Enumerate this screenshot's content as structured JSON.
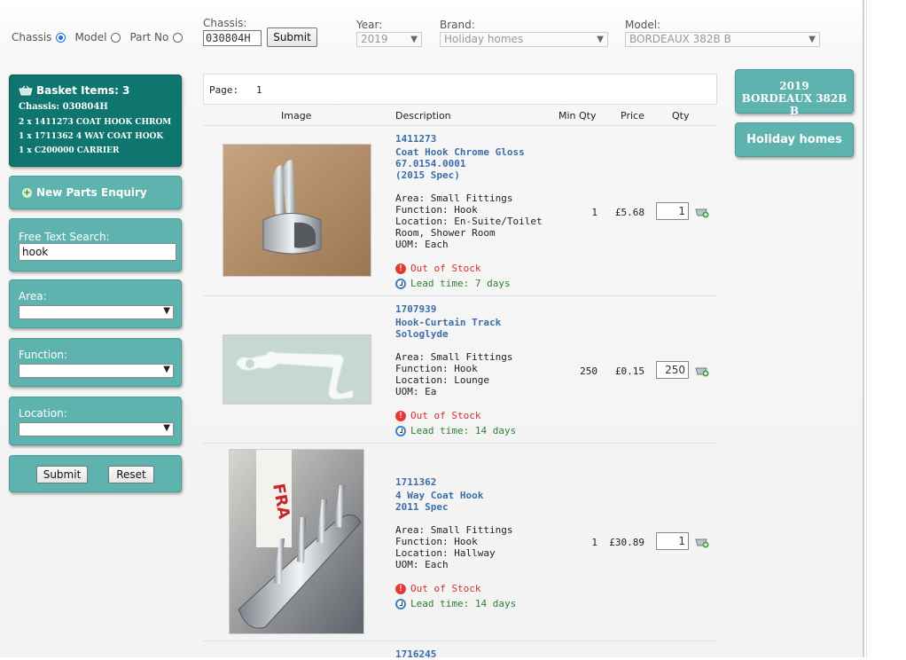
{
  "filters": {
    "radio_chassis": "Chassis",
    "radio_model": "Model",
    "radio_partno": "Part No",
    "chassis_label": "Chassis:",
    "chassis_value": "030804H",
    "submit_label": "Submit",
    "year_label": "Year:",
    "year_value": "2019",
    "brand_label": "Brand:",
    "brand_value": "Holiday homes",
    "model_label": "Model:",
    "model_value": "BORDEAUX 382B B"
  },
  "sidebar": {
    "basket_title": "Basket Items: 3",
    "basket_chassis": "Chassis: 030804H",
    "basket_lines": [
      "2 x 1411273 COAT HOOK CHROM",
      "1 x 1711362 4 WAY COAT HOOK",
      "1 x C200000 CARRIER"
    ],
    "new_parts_enquiry": "New Parts Enquiry",
    "free_text_label": "Free Text Search:",
    "free_text_value": "hook",
    "area_label": "Area:",
    "function_label": "Function:",
    "location_label": "Location:",
    "submit_label": "Submit",
    "reset_label": "Reset"
  },
  "right": {
    "year": "2019",
    "model": "BORDEAUX 382B B",
    "brand": "Holiday homes"
  },
  "results": {
    "page_label": "Page:",
    "page_number": "1",
    "headers": {
      "image": "Image",
      "description": "Description",
      "min_qty": "Min Qty",
      "price": "Price",
      "qty": "Qty"
    },
    "items": [
      {
        "code": "1411273",
        "name": "Coat Hook Chrome Gloss\n67.0154.0001\n(2015 Spec)",
        "area": "Area: Small Fittings",
        "function": "Function: Hook",
        "location": "Location: En-Suite/Toilet",
        "location2": "Room, Shower Room",
        "uom": "UOM: Each",
        "stock": "Out of Stock",
        "lead": "Lead time: 7 days",
        "min_qty": "1",
        "price": "£5.68",
        "qty": "1"
      },
      {
        "code": "1707939",
        "name": "Hook-Curtain Track\nSologlyde",
        "area": "Area: Small Fittings",
        "function": "Function: Hook",
        "location": "Location: Lounge",
        "uom": "UOM: Ea",
        "stock": "Out of Stock",
        "lead": "Lead time: 14 days",
        "min_qty": "250",
        "price": "£0.15",
        "qty": "250"
      },
      {
        "code": "1711362",
        "name": "4 Way Coat Hook\n2011 Spec",
        "area": "Area: Small Fittings",
        "function": "Function: Hook",
        "location": "Location: Hallway",
        "uom": "UOM: Each",
        "stock": "Out of Stock",
        "lead": "Lead time: 14 days",
        "min_qty": "1",
        "price": "£30.89",
        "qty": "1"
      },
      {
        "code": "1716245"
      }
    ]
  },
  "colors": {
    "panel": "#5fb3ae",
    "basket": "#0f766f",
    "link": "#3a6ea5",
    "out_of_stock": "#d32f2f",
    "lead_time": "#2e7d32"
  }
}
